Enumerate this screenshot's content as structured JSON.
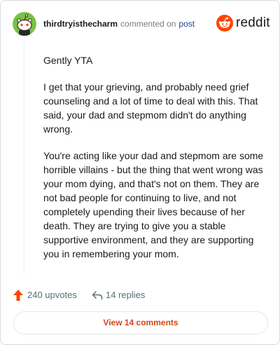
{
  "header": {
    "username": "thirdtryisthecharm",
    "action_text": "commented on",
    "post_link": "post",
    "brand_name": "reddit",
    "brand_color": "#ff4500",
    "avatar_icon": "snoo-avatar-icon",
    "avatar_color": "#7ac143"
  },
  "comment": {
    "paragraphs": [
      "Gently YTA",
      "I get that your grieving, and probably need grief counseling and a lot of time to deal with this. That said, your dad and stepmom didn't do anything wrong.",
      "You're acting like your dad and stepmom are some horrible villains - but the thing that went wrong was your mom dying, and that's not on them. They are not bad people for continuing to live, and not completely upending their lives because of her death. They are trying to give you a stable supportive environment, and they are supporting you in remembering your mom."
    ]
  },
  "actions": {
    "upvotes": "240 upvotes",
    "upvote_color": "#ff4500",
    "replies": "14 replies"
  },
  "footer": {
    "view_comments": "View 14 comments",
    "link_color": "#d4451a"
  }
}
